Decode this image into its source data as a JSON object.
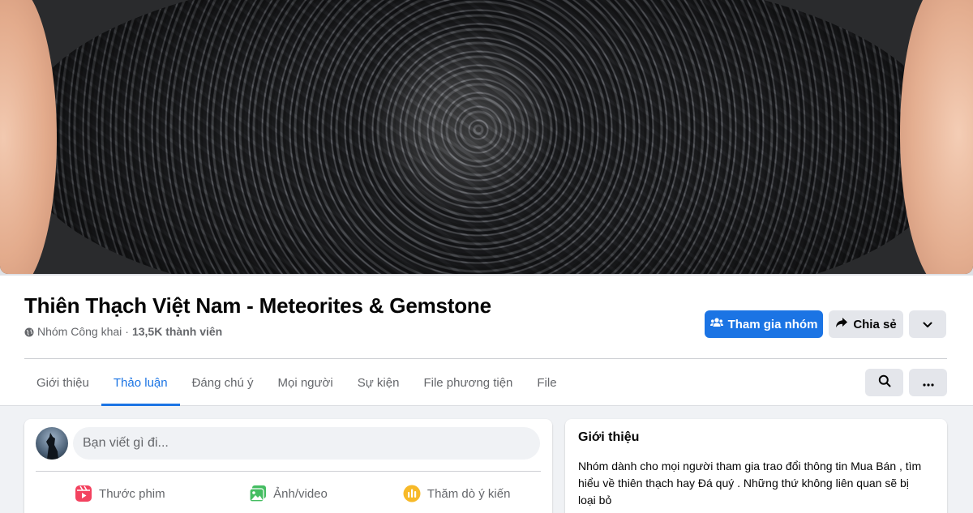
{
  "group": {
    "title": "Thiên Thạch Việt Nam - Meteorites & Gemstone",
    "privacy": "Nhóm Công khai",
    "separator": "·",
    "members": "13,5K thành viên"
  },
  "actions": {
    "join_label": "Tham gia nhóm",
    "share_label": "Chia sẻ"
  },
  "tabs": [
    {
      "label": "Giới thiệu",
      "active": false
    },
    {
      "label": "Thảo luận",
      "active": true
    },
    {
      "label": "Đáng chú ý",
      "active": false
    },
    {
      "label": "Mọi người",
      "active": false
    },
    {
      "label": "Sự kiện",
      "active": false
    },
    {
      "label": "File phương tiện",
      "active": false
    },
    {
      "label": "File",
      "active": false
    }
  ],
  "composer": {
    "placeholder": "Bạn viết gì đi...",
    "actions": [
      {
        "label": "Thước phim",
        "icon": "reel-icon",
        "color": "#f3425f"
      },
      {
        "label": "Ảnh/video",
        "icon": "photo-icon",
        "color": "#45bd62"
      },
      {
        "label": "Thăm dò ý kiến",
        "icon": "poll-icon",
        "color": "#f7b928"
      }
    ]
  },
  "about": {
    "title": "Giới thiệu",
    "text": "Nhóm dành cho mọi người tham gia trao đổi thông tin Mua Bán , tìm hiểu về thiên thạch hay Đá quý . Những thứ không liên quan sẽ bị loại bỏ"
  },
  "colors": {
    "accent": "#1b74e4",
    "secondary_button": "#e4e6eb",
    "muted_text": "#65676b",
    "page_bg": "#f0f2f5"
  }
}
